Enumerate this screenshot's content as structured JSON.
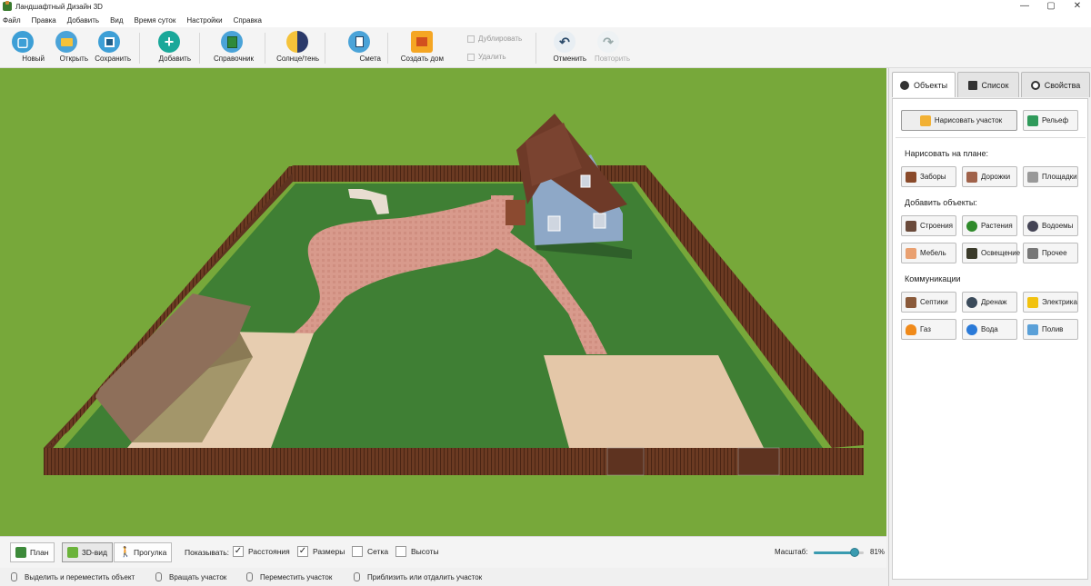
{
  "window": {
    "title": "Ландшафтный Дизайн 3D",
    "minimize": "—",
    "maximize": "▢",
    "close": "✕"
  },
  "menu": [
    "Файл",
    "Правка",
    "Добавить",
    "Вид",
    "Время суток",
    "Настройки",
    "Справка"
  ],
  "toolbar": {
    "new": "Новый",
    "open": "Открыть",
    "save": "Сохранить",
    "add": "Добавить",
    "reference": "Справочник",
    "sun_shadow": "Солнце/тень",
    "estimate": "Смета",
    "create_house": "Создать дом",
    "duplicate": "Дублировать",
    "delete": "Удалить",
    "undo": "Отменить",
    "redo": "Повторить"
  },
  "views": {
    "plan": "План",
    "view3d": "3D-вид",
    "walk": "Прогулка"
  },
  "show": {
    "label": "Показывать:",
    "options": [
      {
        "label": "Расстояния",
        "checked": true
      },
      {
        "label": "Размеры",
        "checked": true
      },
      {
        "label": "Сетка",
        "checked": false
      },
      {
        "label": "Высоты",
        "checked": false
      }
    ]
  },
  "scale": {
    "label": "Масштаб:",
    "value": "81%",
    "fraction": 0.81
  },
  "status": [
    "Выделить и переместить объект",
    "Вращать участок",
    "Переместить участок",
    "Приблизить или отдалить участок"
  ],
  "tabs": {
    "objects": "Объекты",
    "list": "Список",
    "properties": "Свойства"
  },
  "panel": {
    "draw_plot": "Нарисовать участок",
    "relief": "Рельеф",
    "draw_on_plan": "Нарисовать на плане:",
    "fences": "Заборы",
    "paths": "Дорожки",
    "areas": "Площадки",
    "add_objects": "Добавить объекты:",
    "buildings": "Строения",
    "plants": "Растения",
    "ponds": "Водоемы",
    "furniture": "Мебель",
    "lighting": "Освещение",
    "other": "Прочее",
    "communications": "Коммуникации",
    "septic": "Септики",
    "drainage": "Дренаж",
    "electric": "Электрика",
    "gas": "Газ",
    "water": "Вода",
    "watering": "Полив"
  },
  "colors": {
    "grass": "#77a83a",
    "lawn": "#3f7f34",
    "fence": "#6b3a22",
    "path": "#d49486",
    "accent": "#3a9bb0"
  }
}
